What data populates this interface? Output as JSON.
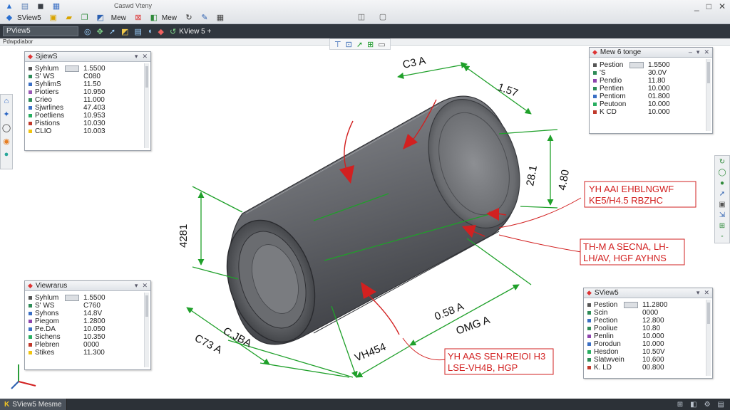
{
  "titlebar": {
    "row1": [
      {
        "name": "app-logo-icon",
        "glyph": "▲"
      },
      {
        "name": "new-file-icon",
        "glyph": "▤"
      },
      {
        "name": "save-icon",
        "glyph": "◼"
      },
      {
        "name": "print-icon",
        "glyph": "▦"
      }
    ],
    "app_label": "SView5",
    "view_label1": "Mew",
    "view_label2": "Mew",
    "doc_title": "Caswd Vteny",
    "window_controls": [
      "_",
      "□",
      "✕"
    ]
  },
  "commandbar": {
    "dropdown_value": "PView5",
    "tab_label": "KView 5 +"
  },
  "subbar": {
    "label": "Pdwpdiabor"
  },
  "panels": {
    "top_left": {
      "title": "SjiewS",
      "rows": [
        {
          "key": "Syhlum",
          "value": "1.5500",
          "has_box": true,
          "color": "#555555"
        },
        {
          "key": "S' WS",
          "value": "C080",
          "has_box": false,
          "color": "#2e8b57"
        },
        {
          "key": "SyhlimS",
          "value": "11.50",
          "has_box": false,
          "color": "#3a6fc4"
        },
        {
          "key": "Piotiers",
          "value": "10.950",
          "has_box": false,
          "color": "#9b59b6"
        },
        {
          "key": "Crieo",
          "value": "11.000",
          "has_box": false,
          "color": "#2e8b57"
        },
        {
          "key": "Sjwrlines",
          "value": "47.403",
          "has_box": false,
          "color": "#3a6fc4"
        },
        {
          "key": "Poetliens",
          "value": "10.953",
          "has_box": false,
          "color": "#27ae60"
        },
        {
          "key": "Pistions",
          "value": "10.030",
          "has_box": false,
          "color": "#c0392b"
        },
        {
          "key": "CLIO",
          "value": "10.003",
          "has_box": false,
          "color": "#f1c40f"
        }
      ]
    },
    "top_right": {
      "title": "Mew 6 tonge",
      "rows": [
        {
          "key": "Pestion",
          "value": "1.5500",
          "has_box": true,
          "color": "#555555"
        },
        {
          "key": "'S",
          "value": "30.0V",
          "has_box": false,
          "color": "#2e8b57"
        },
        {
          "key": "Pendio",
          "value": "11.80",
          "has_box": false,
          "color": "#8e44ad"
        },
        {
          "key": "Pentien",
          "value": "10.000",
          "has_box": false,
          "color": "#2e8b57"
        },
        {
          "key": "Pentiom",
          "value": "01.800",
          "has_box": false,
          "color": "#3a6fc4"
        },
        {
          "key": "Peutoon",
          "value": "10.000",
          "has_box": false,
          "color": "#27ae60"
        },
        {
          "key": "K CD",
          "value": "10.000",
          "has_box": false,
          "color": "#c0392b"
        }
      ]
    },
    "bottom_left": {
      "title": "Viewrarus",
      "rows": [
        {
          "key": "Syhlum",
          "value": "1.5500",
          "has_box": true,
          "color": "#555555"
        },
        {
          "key": "S' WS",
          "value": "C760",
          "has_box": false,
          "color": "#2e8b57"
        },
        {
          "key": "Syhons",
          "value": "14.8V",
          "has_box": false,
          "color": "#3a6fc4"
        },
        {
          "key": "Piegom",
          "value": "1.2800",
          "has_box": false,
          "color": "#8e44ad"
        },
        {
          "key": "Pe.DA",
          "value": "10.050",
          "has_box": false,
          "color": "#3a6fc4"
        },
        {
          "key": "Sichens",
          "value": "10.350",
          "has_box": false,
          "color": "#27ae60"
        },
        {
          "key": "Plebren",
          "value": "0000",
          "has_box": false,
          "color": "#c0392b"
        },
        {
          "key": "Stikes",
          "value": "11.300",
          "has_box": false,
          "color": "#f1c40f"
        }
      ]
    },
    "bottom_right": {
      "title": "SView5",
      "rows": [
        {
          "key": "Pestion",
          "value": "11.2800",
          "has_box": true,
          "color": "#555555"
        },
        {
          "key": "Scin",
          "value": "0000",
          "has_box": false,
          "color": "#2e8b57"
        },
        {
          "key": "Pection",
          "value": "12.800",
          "has_box": false,
          "color": "#3a6fc4"
        },
        {
          "key": "Pooliue",
          "value": "10.80",
          "has_box": false,
          "color": "#2e8b57"
        },
        {
          "key": "Penlin",
          "value": "10.000",
          "has_box": false,
          "color": "#8e44ad"
        },
        {
          "key": "Porodun",
          "value": "10.000",
          "has_box": false,
          "color": "#3a6fc4"
        },
        {
          "key": "Hesdon",
          "value": "10.50V",
          "has_box": false,
          "color": "#27ae60"
        },
        {
          "key": "Slatwvein",
          "value": "10.600",
          "has_box": false,
          "color": "#2e8b57"
        },
        {
          "key": "K. LD",
          "value": "00.800",
          "has_box": false,
          "color": "#c0392b"
        }
      ]
    }
  },
  "dimensions": {
    "top": "C3 A",
    "top_right": "1.57",
    "right_vertical_1": "28.1",
    "right_vertical_2": "4.80",
    "left_vertical": "4281",
    "bottom_left_1": "C.JBA",
    "bottom_left_2": "C73 A",
    "bottom_mid": "0.58 A",
    "bottom_mid_2": "OMG A",
    "bottom_center": "VH454"
  },
  "callouts": [
    {
      "line1": "YH AAI EHBLNGWF",
      "line2": "KE5/H4.5 RBZHC"
    },
    {
      "line1": "TH-M A SECNA, LH-",
      "line2": "LH/AV, HGF AYHNS"
    },
    {
      "line1": "YH AAS SEN-REIOI H3",
      "line2": "LSE-VH4B, HGP"
    }
  ],
  "statusbar": {
    "tab_label": "SView5 Mesme",
    "right_icons": [
      "⊞",
      "◧",
      "⚙",
      "▤"
    ]
  },
  "colors": {
    "dimension_green": "#1fa02a",
    "callout_red": "#d22020",
    "cylinder_body": "#6d6f74"
  }
}
